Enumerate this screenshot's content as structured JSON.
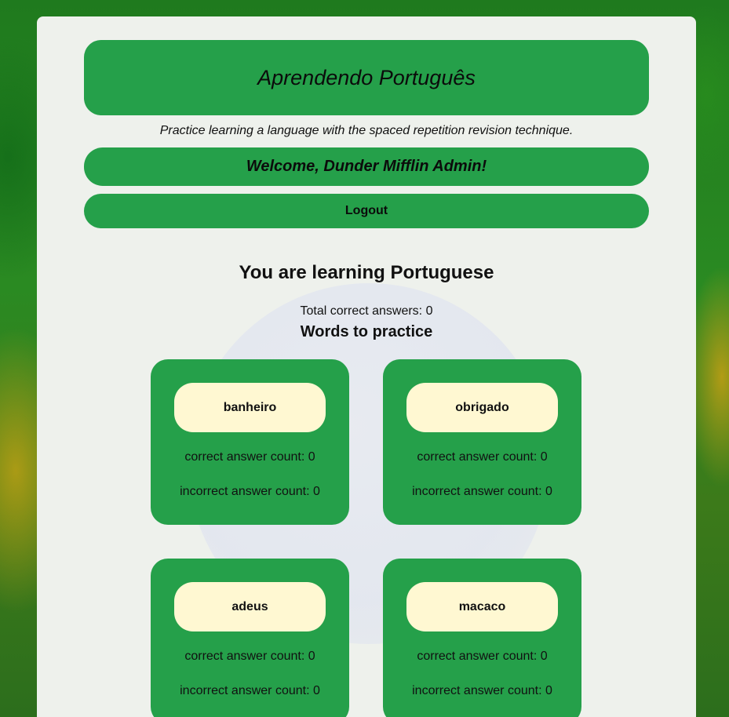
{
  "header": {
    "title": "Aprendendo Português",
    "tagline": "Practice learning a language with the spaced repetition revision technique.",
    "welcome": "Welcome, Dunder Mifflin Admin!",
    "logout_label": "Logout"
  },
  "dashboard": {
    "heading": "You are learning Portuguese",
    "total_correct": "Total correct answers: 0",
    "words_heading": "Words to practice"
  },
  "words": [
    {
      "word": "banheiro",
      "correct": "correct answer count: 0",
      "incorrect": "incorrect answer count: 0"
    },
    {
      "word": "obrigado",
      "correct": "correct answer count: 0",
      "incorrect": "incorrect answer count: 0"
    },
    {
      "word": "adeus",
      "correct": "correct answer count: 0",
      "incorrect": "incorrect answer count: 0"
    },
    {
      "word": "macaco",
      "correct": "correct answer count: 0",
      "incorrect": "incorrect answer count: 0"
    }
  ],
  "colors": {
    "brand_green": "#25a04a",
    "word_pill": "#fff8d2",
    "panel": "#eef1ec"
  }
}
